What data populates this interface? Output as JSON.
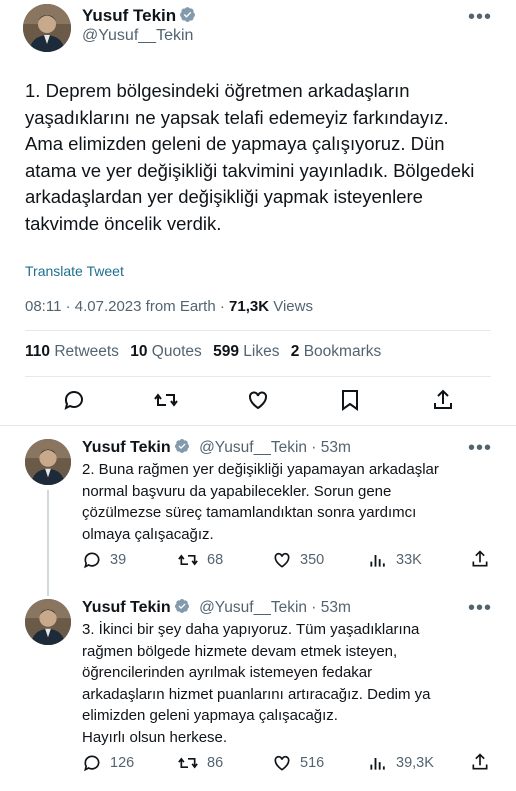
{
  "main_tweet": {
    "author_name": "Yusuf Tekin",
    "author_handle": "@Yusuf__Tekin",
    "text": "1. Deprem bölgesindeki öğretmen arkadaşların\nyaşadıklarını ne yapsak telafi edemeyiz farkındayız.\nAma elimizden geleni de yapmaya çalışıyoruz. Dün\natama ve yer değişikliği takvimini yayınladık. Bölgedeki\narkadaşlardan yer değişikliği yapmak isteyenlere\ntakvimde öncelik verdik.",
    "translate": "Translate Tweet",
    "time_date": "08:11 · 4.07.2023 from Earth · ",
    "views_count": "71,3K",
    "views_label": " Views",
    "stats": {
      "retweets_count": "110",
      "retweets_label": " Retweets",
      "quotes_count": "10",
      "quotes_label": " Quotes",
      "likes_count": "599",
      "likes_label": " Likes",
      "bookmarks_count": "2",
      "bookmarks_label": " Bookmarks"
    }
  },
  "replies": [
    {
      "author_name": "Yusuf Tekin",
      "handle_time": "@Yusuf__Tekin · 53m",
      "text": "2. Buna rağmen yer değişikliği yapamayan arkadaşlar\nnormal başvuru da yapabilecekler. Sorun gene\nçözülmezse süreç tamamlandıktan sonra yardımcı\nolmaya çalışacağız.",
      "replies": "39",
      "retweets": "68",
      "likes": "350",
      "views": "33K"
    },
    {
      "author_name": "Yusuf Tekin",
      "handle_time": "@Yusuf__Tekin · 53m",
      "text": "3. İkinci bir şey daha yapıyoruz. Tüm yaşadıklarına\nrağmen bölgede hizmete devam etmek isteyen,\nöğrencilerinden ayrılmak istemeyen fedakar\narkadaşların hizmet puanlarını artıracağız. Dedim ya\nelimizden geleni yapmaya çalışacağız.\nHayırlı olsun herkese.",
      "replies": "126",
      "retweets": "86",
      "likes": "516",
      "views": "39,3K"
    }
  ],
  "icons": {
    "verified": "verified-badge-icon",
    "more": "more-icon",
    "reply": "reply-icon",
    "retweet": "retweet-icon",
    "like": "like-icon",
    "bookmark": "bookmark-icon",
    "share": "share-icon",
    "views": "views-icon"
  },
  "colors": {
    "link": "#1d6f8e",
    "verified": "#829aab",
    "muted": "#536471"
  }
}
